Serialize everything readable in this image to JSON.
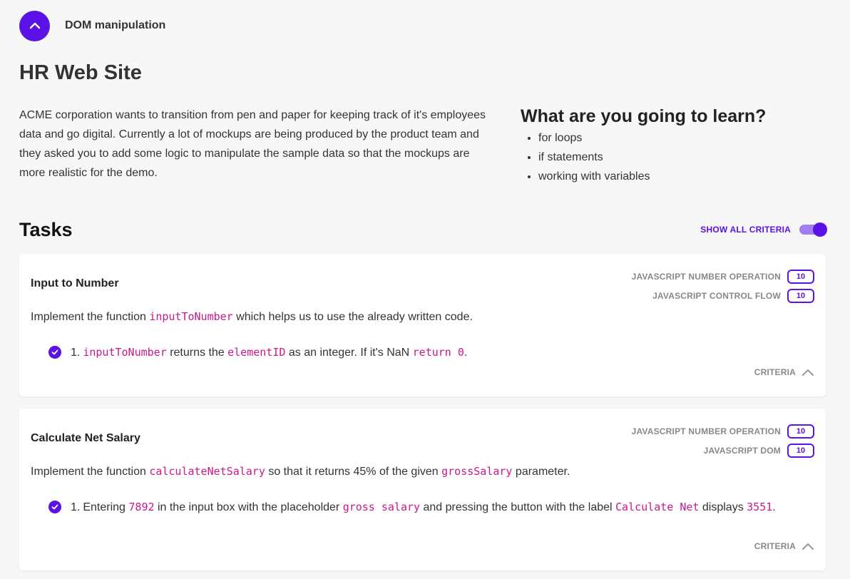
{
  "header": {
    "collapse_icon": "chevron-up-icon",
    "section_title": "DOM manipulation"
  },
  "project": {
    "title": "HR Web Site",
    "description": "ACME corporation wants to transition from pen and paper for keeping track of it's employees data and go digital. Currently a lot of mockups are being produced by the product team and they asked you to add some logic to manipulate the sample data so that the mockups are more realistic for the demo."
  },
  "learn": {
    "title": "What are you going to learn?",
    "items": [
      "for loops",
      "if statements",
      "working with variables"
    ]
  },
  "tasks": {
    "title": "Tasks",
    "show_all_criteria_label": "SHOW ALL CRITERIA",
    "show_all_criteria_enabled": true,
    "list": [
      {
        "title": "Input to Number",
        "tags": [
          {
            "name": "JAVASCRIPT NUMBER OPERATION",
            "points": "10"
          },
          {
            "name": "JAVASCRIPT CONTROL FLOW",
            "points": "10"
          }
        ],
        "desc_prefix": "Implement the function ",
        "desc_code": "inputToNumber",
        "desc_suffix": " which helps us to use the already written code.",
        "criterion": {
          "number": "1.",
          "code1": "inputToNumber",
          "text1": " returns the ",
          "code2": "elementID",
          "text2": " as an integer. If it's NaN ",
          "code3": "return 0",
          "text3": "."
        },
        "criteria_label": "CRITERIA"
      },
      {
        "title": "Calculate Net Salary",
        "tags": [
          {
            "name": "JAVASCRIPT NUMBER OPERATION",
            "points": "10"
          },
          {
            "name": "JAVASCRIPT DOM",
            "points": "10"
          }
        ],
        "desc_prefix": "Implement the function ",
        "desc_code": "calculateNetSalary",
        "desc_middle": " so that it returns 45% of the given ",
        "desc_code2": "grossSalary",
        "desc_suffix": " parameter.",
        "criterion": {
          "number": "1.",
          "text0": "Entering ",
          "code1": "7892",
          "text1": " in the input box with the placeholder ",
          "code2": "gross salary",
          "text2": " and pressing the button with the label ",
          "code3": "Calculate Net",
          "text3": " displays ",
          "code4": "3551",
          "text4": "."
        },
        "criteria_label": "CRITERIA"
      }
    ]
  },
  "colors": {
    "accent": "#5a12e6",
    "code": "#c9188d"
  }
}
